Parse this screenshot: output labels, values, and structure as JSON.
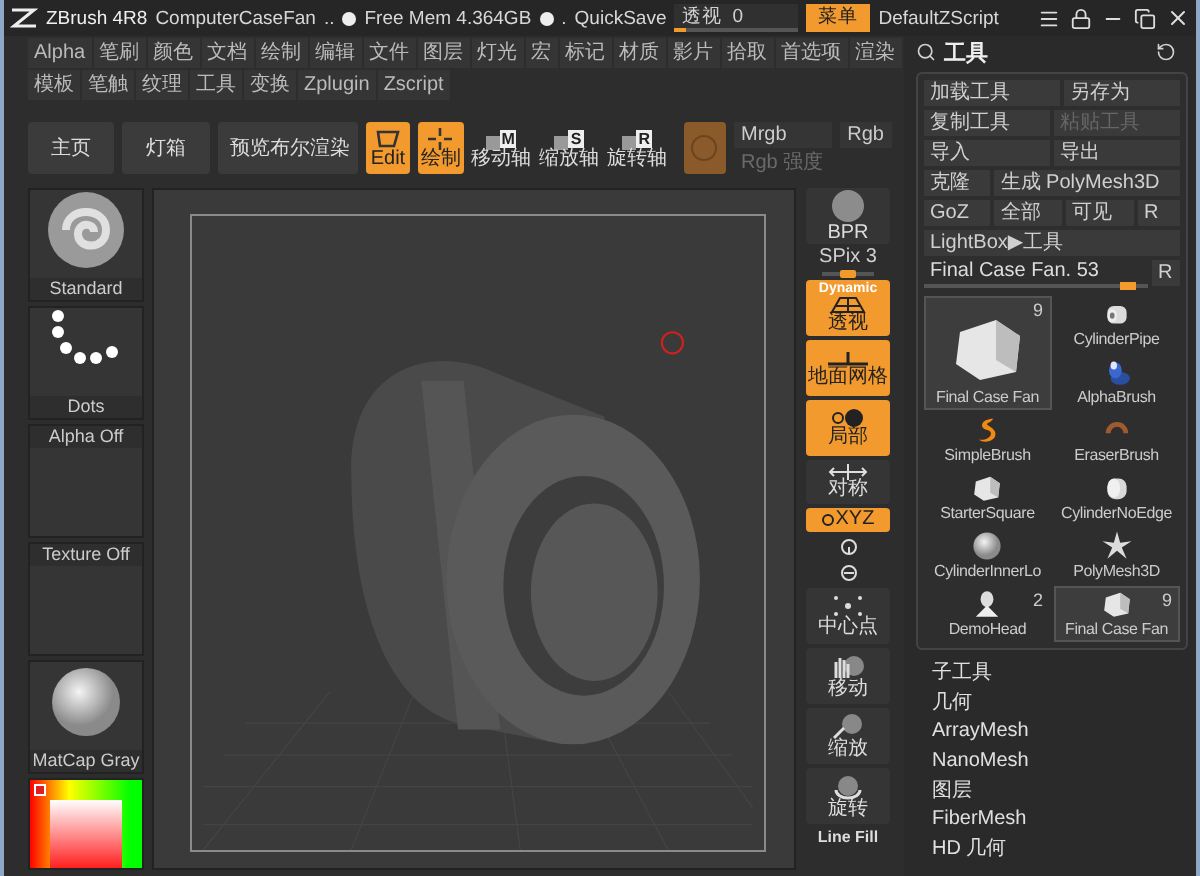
{
  "title_bar": {
    "app": "ZBrush 4R8",
    "document": "ComputerCaseFan",
    "ellipsis": "..",
    "free_mem": "Free Mem 4.364GB",
    "dot": ".",
    "quicksave": "QuickSave",
    "slider": {
      "label": "透视",
      "value": "0",
      "level": 0.1
    },
    "menu_button": {
      "label": "菜单",
      "active": true
    },
    "script": "DefaultZScript"
  },
  "menu_rows": [
    [
      "Alpha",
      "笔刷",
      "颜色",
      "文档",
      "绘制",
      "编辑",
      "文件",
      "图层",
      "灯光",
      "宏",
      "标记",
      "材质",
      "影片",
      "拾取",
      "首选项",
      "渲染"
    ],
    [
      "模板",
      "笔触",
      "纹理",
      "工具",
      "变换",
      "Zplugin",
      "Zscript"
    ]
  ],
  "toolbar": {
    "buttons": [
      {
        "label": "主页"
      },
      {
        "label": "灯箱"
      },
      {
        "label": "预览布尔渲染"
      }
    ],
    "modes": [
      {
        "label": "Edit",
        "kind": "edit",
        "active": true
      },
      {
        "label": "绘制",
        "kind": "draw",
        "active": true
      },
      {
        "label": "移动轴",
        "kind": "move",
        "badge": "M",
        "active": false
      },
      {
        "label": "缩放轴",
        "kind": "scale",
        "badge": "S",
        "active": false
      },
      {
        "label": "旋转轴",
        "kind": "rotate",
        "badge": "R",
        "active": false
      }
    ],
    "material_swatch": {
      "color": "#8a5a2a"
    },
    "mrgb": "Mrgb",
    "rgb": "Rgb",
    "rgb_intensity": {
      "label": "Rgb 强度",
      "disabled": true
    }
  },
  "left_shelf": [
    {
      "label": "Standard",
      "kind": "brush"
    },
    {
      "label": "Dots",
      "kind": "dots"
    },
    {
      "label": "Alpha Off",
      "kind": "empty"
    },
    {
      "label": "Texture Off",
      "kind": "empty"
    },
    {
      "label": "MatCap Gray",
      "kind": "sphere"
    }
  ],
  "right_shelf": [
    {
      "label": "BPR",
      "kind": "bpr",
      "active": false
    },
    {
      "label": "SPix 3",
      "kind": "spix",
      "level": 0.5
    },
    {
      "label": "透视",
      "kind": "persp",
      "top": "Dynamic",
      "active": true
    },
    {
      "label": "地面网格",
      "kind": "floor",
      "active": true
    },
    {
      "label": "局部",
      "kind": "local",
      "active": true
    },
    {
      "label": "对称",
      "kind": "sym",
      "active": false
    },
    {
      "label": "XYZ",
      "kind": "xyz",
      "active": true
    },
    {
      "kind": "rot_y",
      "active": false
    },
    {
      "kind": "rot_z",
      "active": false
    },
    {
      "label": "中心点",
      "kind": "center",
      "active": false
    },
    {
      "label": "移动",
      "kind": "move",
      "active": false
    },
    {
      "label": "缩放",
      "kind": "scale",
      "active": false
    },
    {
      "label": "旋转",
      "kind": "rotate",
      "active": false
    },
    {
      "label": "Line Fill",
      "kind": "linefill",
      "active": false
    }
  ],
  "tool_panel": {
    "title": "工具",
    "button_rows": [
      [
        {
          "label": "加载工具",
          "disabled": false
        },
        {
          "label": "另存为",
          "disabled": false
        }
      ],
      [
        {
          "label": "复制工具",
          "disabled": false
        },
        {
          "label": "粘贴工具",
          "disabled": true
        }
      ],
      [
        {
          "label": "导入",
          "disabled": false
        },
        {
          "label": "导出",
          "disabled": false
        }
      ],
      [
        {
          "label": "克隆",
          "disabled": false
        },
        {
          "label": "生成 PolyMesh3D",
          "disabled": false
        }
      ],
      [
        {
          "label": "GoZ",
          "disabled": false
        },
        {
          "label": "全部",
          "disabled": false
        },
        {
          "label": "可见",
          "disabled": false
        },
        {
          "label": "R",
          "disabled": false
        }
      ],
      [
        {
          "label": "LightBox▶工具",
          "disabled": false
        }
      ]
    ],
    "slider": {
      "label": "Final Case Fan. 53",
      "level": 0.95,
      "reset": "R"
    },
    "main_tile": {
      "label": "Final Case Fan",
      "count": "9",
      "selected": true,
      "kind": "cube"
    },
    "tiles": [
      {
        "label": "CylinderPipe",
        "kind": "pipe",
        "selected": false
      },
      {
        "label": "AlphaBrush",
        "kind": "alphabrush",
        "selected": false
      },
      {
        "label": "SimpleBrush",
        "kind": "simplebrush",
        "selected": false
      },
      {
        "label": "EraserBrush",
        "kind": "eraser",
        "selected": false
      },
      {
        "label": "StarterSquare",
        "kind": "cube",
        "selected": false
      },
      {
        "label": "CylinderNoEdge",
        "kind": "cylinder",
        "selected": false
      },
      {
        "label": "CylinderInnerLo",
        "kind": "sphere",
        "selected": false
      },
      {
        "label": "PolyMesh3D",
        "kind": "star",
        "selected": false
      },
      {
        "label": "DemoHead",
        "kind": "head",
        "count": "2",
        "selected": false
      },
      {
        "label": "Final Case Fan",
        "kind": "cube",
        "count": "9",
        "selected": true
      }
    ],
    "sections": [
      "子工具",
      "几何",
      "ArrayMesh",
      "NanoMesh",
      "图层",
      "FiberMesh",
      "HD 几何"
    ]
  }
}
